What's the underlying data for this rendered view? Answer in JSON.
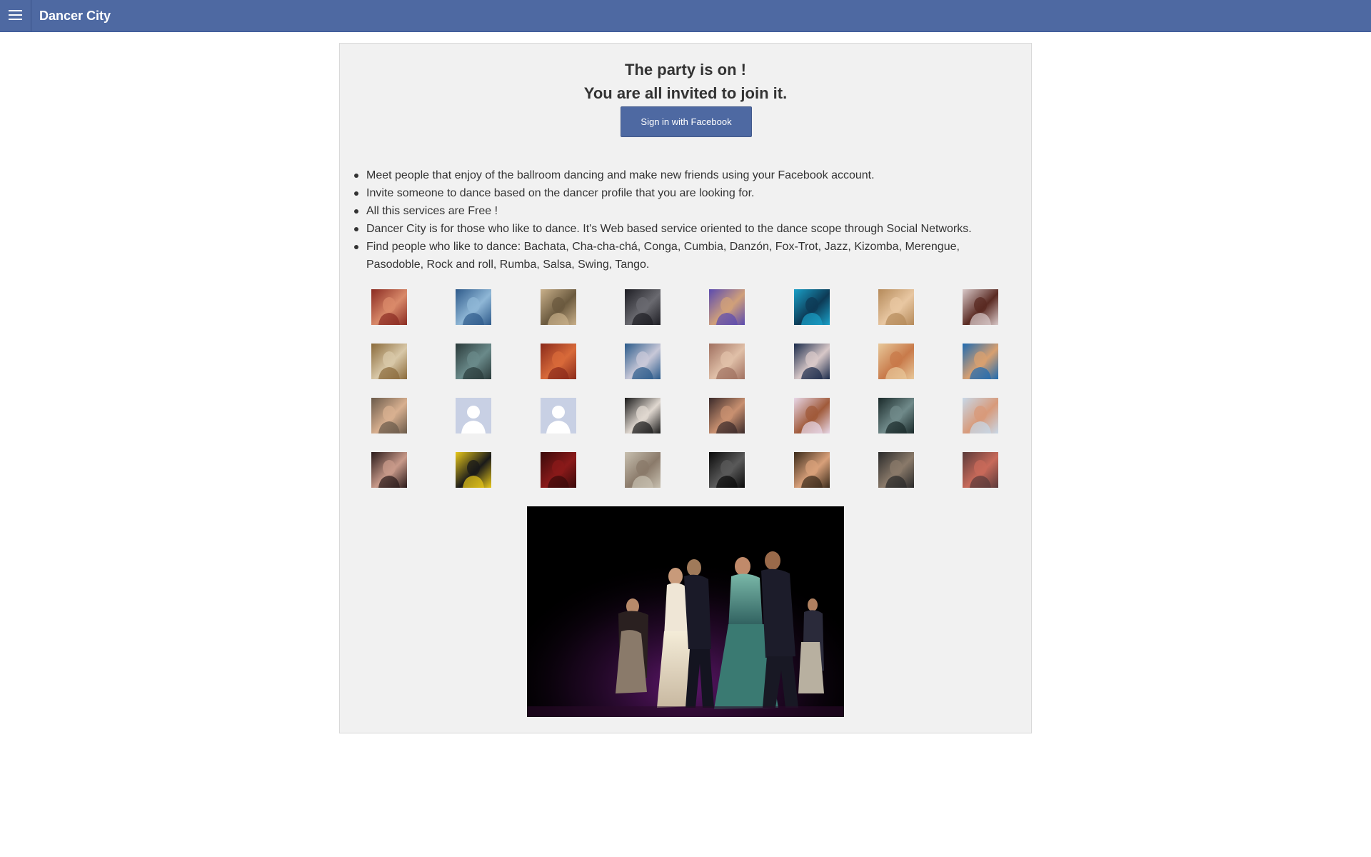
{
  "header": {
    "brand": "Dancer City",
    "menu_icon": "hamburger-menu-icon",
    "color": "#4e69a2"
  },
  "main": {
    "headline_line1": "The party is on !",
    "headline_line2": "You are all invited to join it.",
    "signin_label": "Sign in with Facebook",
    "features": [
      "Meet people that enjoy of the ballroom dancing and make new friends using your Facebook account.",
      "Invite someone to dance based on the dancer profile that you are looking for.",
      "All this services are Free !",
      "Dancer City is for those who like to dance. It's Web based service oriented to the dance scope through Social Networks.",
      "Find people who like to dance: Bachata, Cha-cha-chá, Conga, Cumbia, Danzón, Fox-Trot, Jazz, Kizomba, Merengue, Pasodoble, Rock and roll, Rumba, Salsa, Swing, Tango."
    ],
    "avatars": [
      {
        "colors": [
          "#8a2b22",
          "#d98a6a"
        ]
      },
      {
        "colors": [
          "#2e5a8a",
          "#8fb7d6"
        ]
      },
      {
        "colors": [
          "#c9b08a",
          "#6b5a3f"
        ]
      },
      {
        "colors": [
          "#1e1e24",
          "#6a6a70"
        ]
      },
      {
        "colors": [
          "#5a4ab0",
          "#d0a07a"
        ]
      },
      {
        "colors": [
          "#1aa0c8",
          "#0d3a55"
        ]
      },
      {
        "colors": [
          "#b58a5a",
          "#e8c7a2"
        ]
      },
      {
        "colors": [
          "#d9c9c9",
          "#5a2a22"
        ]
      },
      {
        "colors": [
          "#8a6a3a",
          "#d8c8a8"
        ]
      },
      {
        "colors": [
          "#2a3a3a",
          "#6a8a8a"
        ]
      },
      {
        "colors": [
          "#8a2a1a",
          "#d86a3a"
        ]
      },
      {
        "colors": [
          "#2a5a8a",
          "#c8c8d8"
        ]
      },
      {
        "colors": [
          "#a07060",
          "#e0c0a8"
        ]
      },
      {
        "colors": [
          "#1a2a4a",
          "#d8c8c8"
        ]
      },
      {
        "colors": [
          "#e8c89a",
          "#c87a4a"
        ]
      },
      {
        "colors": [
          "#1e6ab0",
          "#d8a070"
        ]
      },
      {
        "colors": [
          "#6a5a4a",
          "#d8b090"
        ]
      },
      {
        "colors": [
          "#c8d0e4",
          "#ffffff"
        ],
        "placeholder": true
      },
      {
        "colors": [
          "#c8d0e4",
          "#ffffff"
        ],
        "placeholder": true
      },
      {
        "colors": [
          "#1a1a1a",
          "#e0d8d0"
        ]
      },
      {
        "colors": [
          "#3a2a2a",
          "#c89070"
        ]
      },
      {
        "colors": [
          "#e8d8e8",
          "#a05a3a"
        ]
      },
      {
        "colors": [
          "#1a2a2a",
          "#708a8a"
        ]
      },
      {
        "colors": [
          "#c8d8e8",
          "#d89a7a"
        ]
      },
      {
        "colors": [
          "#2a1a1a",
          "#c89a8a"
        ]
      },
      {
        "colors": [
          "#e8c81a",
          "#1a1a1a"
        ]
      },
      {
        "colors": [
          "#3a0a0a",
          "#8a1a1a"
        ]
      },
      {
        "colors": [
          "#c8c0b0",
          "#8a7a6a"
        ]
      },
      {
        "colors": [
          "#0a0a0a",
          "#5a5a5a"
        ]
      },
      {
        "colors": [
          "#3a2a1a",
          "#d8a07a"
        ]
      },
      {
        "colors": [
          "#2a2a2a",
          "#8a7a6a"
        ]
      },
      {
        "colors": [
          "#5a3a3a",
          "#c86a5a"
        ]
      }
    ]
  }
}
